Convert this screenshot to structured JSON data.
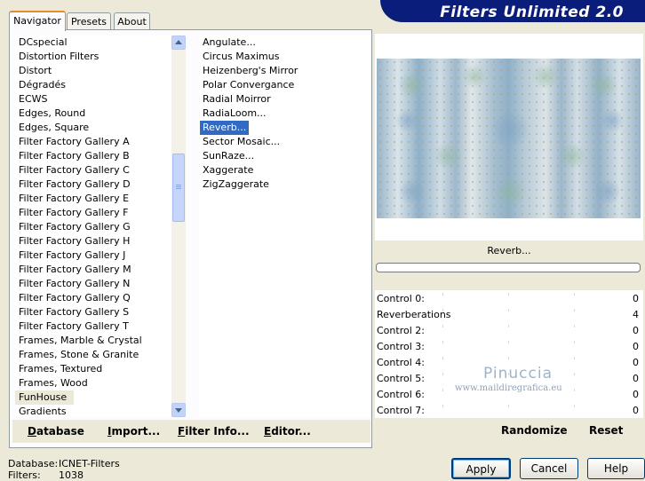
{
  "banner_title": "Filters Unlimited 2.0",
  "tabs": [
    {
      "label": "Navigator",
      "active": true
    },
    {
      "label": "Presets",
      "active": false
    },
    {
      "label": "About",
      "active": false
    }
  ],
  "categories": [
    "DCspecial",
    "Distortion Filters",
    "Distort",
    "Dégradés",
    "ECWS",
    "Edges, Round",
    "Edges, Square",
    "Filter Factory Gallery A",
    "Filter Factory Gallery B",
    "Filter Factory Gallery C",
    "Filter Factory Gallery D",
    "Filter Factory Gallery E",
    "Filter Factory Gallery F",
    "Filter Factory Gallery G",
    "Filter Factory Gallery H",
    "Filter Factory Gallery J",
    "Filter Factory Gallery M",
    "Filter Factory Gallery N",
    "Filter Factory Gallery Q",
    "Filter Factory Gallery S",
    "Filter Factory Gallery T",
    "Frames, Marble & Crystal",
    "Frames, Stone & Granite",
    "Frames, Textured",
    "Frames, Wood",
    "FunHouse",
    "Gradients"
  ],
  "selected_category": "FunHouse",
  "filters": [
    "Angulate...",
    "Circus Maximus",
    "Heizenberg's Mirror",
    "Polar Convergance",
    "Radial Moirror",
    "RadiaLoom...",
    "Reverb...",
    "Sector Mosaic...",
    "SunRaze...",
    "Xaggerate",
    "ZigZaggerate"
  ],
  "selected_filter": "Reverb...",
  "tab_buttons": {
    "database": "Database",
    "import": "Import...",
    "filter_info": "Filter Info...",
    "editor": "Editor..."
  },
  "preview_filter_name": "Reverb...",
  "controls": [
    {
      "label": "Control 0:",
      "value": "0"
    },
    {
      "label": "Reverberations",
      "value": "4"
    },
    {
      "label": "Control 2:",
      "value": "0"
    },
    {
      "label": "Control 3:",
      "value": "0"
    },
    {
      "label": "Control 4:",
      "value": "0"
    },
    {
      "label": "Control 5:",
      "value": "0"
    },
    {
      "label": "Control 6:",
      "value": "0"
    },
    {
      "label": "Control 7:",
      "value": "0"
    }
  ],
  "randomize_label": "Randomize",
  "reset_label": "Reset",
  "status": {
    "database_label": "Database:",
    "database_value": "ICNET-Filters",
    "filters_label": "Filters:",
    "filters_value": "1038"
  },
  "buttons": {
    "apply": "Apply",
    "cancel": "Cancel",
    "help": "Help"
  },
  "watermark": {
    "name": "Pinuccia",
    "url": "www.maildiregrafica.eu"
  },
  "colors": {
    "banner": "#0b1d7a",
    "selection": "#316ac5",
    "preview_base": "#a9c0d2"
  }
}
